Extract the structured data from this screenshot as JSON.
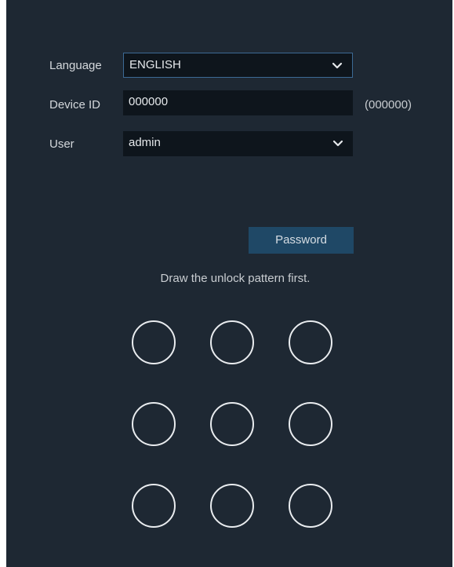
{
  "form": {
    "language": {
      "label": "Language",
      "value": "ENGLISH"
    },
    "device_id": {
      "label": "Device ID",
      "value": "000000",
      "hint": "(000000)"
    },
    "user": {
      "label": "User",
      "value": "admin"
    }
  },
  "password_button": "Password",
  "pattern": {
    "prompt": "Draw the unlock pattern first.",
    "rows": 3,
    "cols": 3
  },
  "colors": {
    "panel_bg": "#1e2833",
    "field_bg": "#0e151c",
    "focus_border": "#3c6a95",
    "button_bg": "#1f4866",
    "dot_stroke": "#e9ecef"
  }
}
